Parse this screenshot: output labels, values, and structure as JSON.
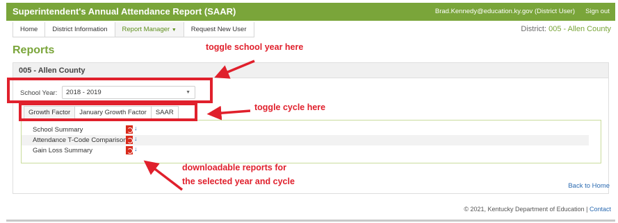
{
  "header": {
    "app_title": "Superintendent's Annual Attendance Report (SAAR)",
    "user": "Brad.Kennedy@education.ky.gov (District User)",
    "sign_out": "Sign out"
  },
  "nav": {
    "tabs": [
      "Home",
      "District Information",
      "Report Manager",
      "Request New User"
    ],
    "active": "Report Manager"
  },
  "district": {
    "label": "District:",
    "value": "005 - Allen County"
  },
  "page_title": "Reports",
  "panel": {
    "title": "005 - Allen County",
    "school_year_label": "School Year:",
    "school_year_value": "2018 - 2019",
    "cycle_tabs": [
      "Growth Factor",
      "January Growth Factor",
      "SAAR"
    ],
    "active_cycle": "Growth Factor",
    "reports": [
      "School Summary",
      "Attendance T-Code Comparison",
      "Gain Loss Summary"
    ]
  },
  "back_home": "Back to Home",
  "footer": {
    "copyright": "© 2021, Kentucky Department of Education |",
    "contact": "Contact"
  },
  "annotations": {
    "toggle_year": "toggle school year here",
    "toggle_cycle": "toggle cycle here",
    "downloads_line1": "downloadable reports for",
    "downloads_line2": "the selected year and cycle",
    "color": "#e0202c"
  },
  "icons": {
    "pdf": "pdf-icon",
    "download": "download-arrow-icon"
  }
}
